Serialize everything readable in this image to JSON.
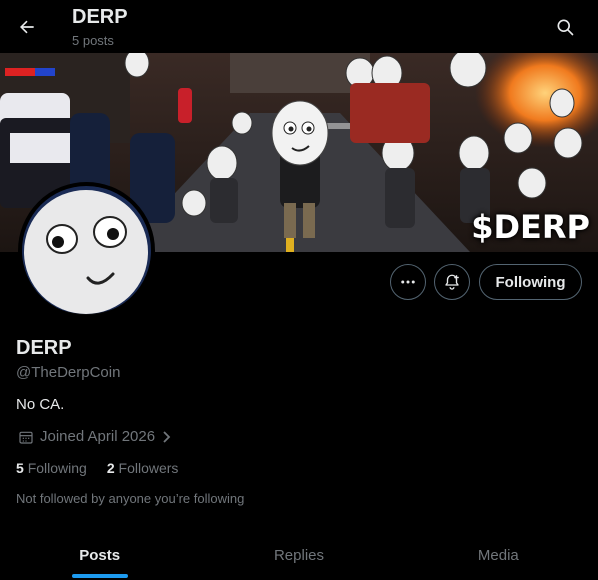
{
  "header": {
    "title": "DERP",
    "post_count": "5 posts"
  },
  "banner": {
    "tagline": "$DERP"
  },
  "actions": {
    "following_label": "Following",
    "more_icon": "more-icon",
    "notify_icon": "bell-plus-icon"
  },
  "profile": {
    "name": "DERP",
    "handle": "@TheDerpCoin",
    "bio": "No CA.",
    "joined": "Joined April 2026",
    "following_count": "5",
    "following_label": "Following",
    "followers_count": "2",
    "followers_label": "Followers",
    "followed_by_note": "Not followed by anyone you’re following"
  },
  "tabs": [
    {
      "label": "Posts",
      "active": true
    },
    {
      "label": "Replies",
      "active": false
    },
    {
      "label": "Media",
      "active": false
    }
  ],
  "colors": {
    "accent": "#1d9bf0",
    "background": "#000000",
    "muted": "#71767b",
    "text": "#e7e9ea"
  }
}
